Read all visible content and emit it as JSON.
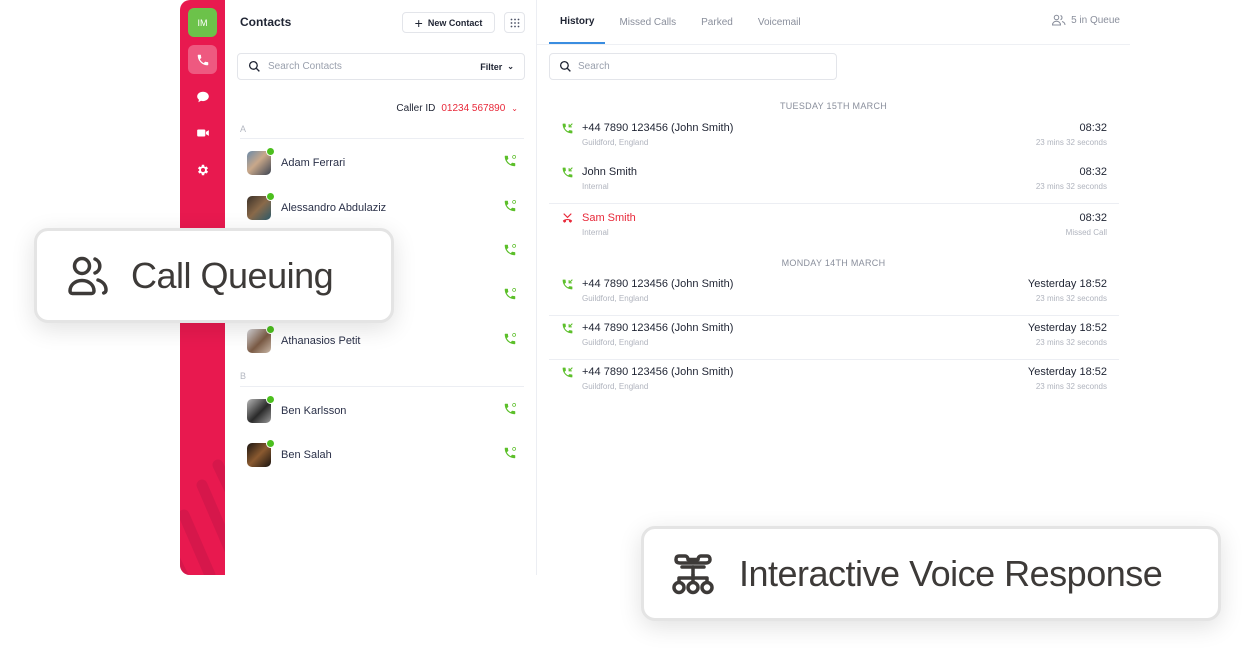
{
  "rail": {
    "user_initials": "IM",
    "items": [
      {
        "name": "phone",
        "active": true
      },
      {
        "name": "chat",
        "active": false
      },
      {
        "name": "video",
        "active": false
      },
      {
        "name": "settings",
        "active": false
      }
    ],
    "brand_color": "#e8194f",
    "avatar_color": "#6cc24a"
  },
  "contacts": {
    "title": "Contacts",
    "new_contact_label": "New Contact",
    "search_placeholder": "Search Contacts",
    "filter_label": "Filter",
    "caller_id_label": "Caller ID",
    "caller_id_value": "01234 567890",
    "sections": [
      {
        "letter": "A",
        "contacts": [
          {
            "name": "Adam Ferrari",
            "status": "online"
          },
          {
            "name": "Alessandro Abdulaziz",
            "status": "online"
          },
          {
            "name": "",
            "status": "online"
          },
          {
            "name": "",
            "status": "online"
          },
          {
            "name": "Athanasios Petit",
            "status": "online"
          }
        ]
      },
      {
        "letter": "B",
        "contacts": [
          {
            "name": "Ben Karlsson",
            "status": "online"
          },
          {
            "name": "Ben Salah",
            "status": "online"
          }
        ]
      }
    ]
  },
  "history": {
    "tabs": [
      {
        "label": "History",
        "active": true
      },
      {
        "label": "Missed Calls",
        "active": false
      },
      {
        "label": "Parked",
        "active": false
      },
      {
        "label": "Voicemail",
        "active": false
      }
    ],
    "queue_label": "5 in Queue",
    "search_placeholder": "Search",
    "days": [
      {
        "label": "TUESDAY 15TH MARCH",
        "calls": [
          {
            "name": "+44 7890 123456 (John Smith)",
            "sub": "Guildford, England",
            "time": "08:32",
            "duration": "23 mins 32 seconds",
            "type": "incoming"
          },
          {
            "name": "John Smith",
            "sub": "Internal",
            "time": "08:32",
            "duration": "23 mins 32 seconds",
            "type": "incoming"
          },
          {
            "name": "Sam Smith",
            "sub": "Internal",
            "time": "08:32",
            "duration": "Missed Call",
            "type": "missed"
          }
        ]
      },
      {
        "label": "MONDAY 14TH MARCH",
        "calls": [
          {
            "name": "+44 7890 123456 (John Smith)",
            "sub": "Guildford, England",
            "time": "Yesterday 18:52",
            "duration": "23 mins 32 seconds",
            "type": "incoming"
          },
          {
            "name": "+44 7890 123456 (John Smith)",
            "sub": "Guildford, England",
            "time": "Yesterday 18:52",
            "duration": "23 mins 32 seconds",
            "type": "incoming"
          },
          {
            "name": "+44 7890 123456 (John Smith)",
            "sub": "Guildford, England",
            "time": "Yesterday 18:52",
            "duration": "23 mins 32 seconds",
            "type": "incoming"
          }
        ]
      }
    ],
    "colors": {
      "incoming": "#5cbf2a",
      "missed": "#e8293a",
      "tab_active": "#3a8de0"
    }
  },
  "badges": {
    "call_queuing": "Call Queuing",
    "ivr": "Interactive Voice Response"
  }
}
